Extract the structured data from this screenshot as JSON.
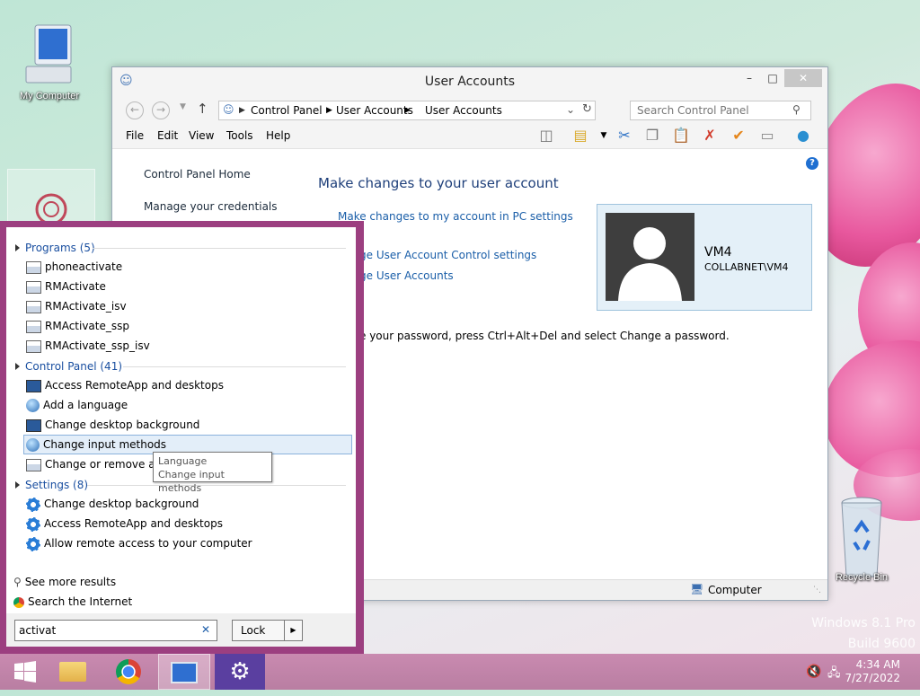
{
  "desktop": {
    "icons": [
      {
        "label": "My Computer"
      },
      {
        "label": "Recycle Bin"
      }
    ],
    "watermark": {
      "line1": "Windows 8.1 Pro",
      "line2": "Build 9600"
    }
  },
  "window": {
    "title": "User Accounts",
    "address": {
      "crumbs": [
        "Control Panel",
        "User Accounts",
        "User Accounts"
      ],
      "search_placeholder": "Search Control Panel"
    },
    "menu": [
      "File",
      "Edit",
      "View",
      "Tools",
      "Help"
    ],
    "left_nav": [
      "Control Panel Home",
      "Manage your credentials"
    ],
    "main": {
      "heading": "Make changes to your user account",
      "links": [
        "Make changes to my account in PC settings",
        "ge User Account Control settings",
        "ge User Accounts"
      ],
      "password_note": "e your password, press Ctrl+Alt+Del and select Change a password."
    },
    "user_card": {
      "name": "VM4",
      "domain": "COLLABNET\\VM4"
    },
    "status": {
      "computer": "Computer"
    }
  },
  "search_panel": {
    "groups": [
      {
        "label": "Programs (5)",
        "items": [
          "phoneactivate",
          "RMActivate",
          "RMActivate_isv",
          "RMActivate_ssp",
          "RMActivate_ssp_isv"
        ]
      },
      {
        "label": "Control Panel (41)",
        "items": [
          "Access RemoteApp and desktops",
          "Add a language",
          "Change desktop background",
          "Change input methods",
          "Change or remove a pr"
        ]
      },
      {
        "label": "Settings (8)",
        "items": [
          "Change desktop background",
          "Access RemoteApp and desktops",
          "Allow remote access to your computer"
        ]
      }
    ],
    "see_more": "See more results",
    "search_internet": "Search the Internet",
    "query": "activat",
    "lock_label": "Lock",
    "tooltip": {
      "line1": "Language",
      "line2": "Change input methods"
    }
  },
  "taskbar": {
    "time": "4:34 AM",
    "date": "7/27/2022"
  },
  "colors": {
    "accent": "#9c3f80",
    "link": "#1a5ea8",
    "taskbar": "#c98ab0"
  }
}
